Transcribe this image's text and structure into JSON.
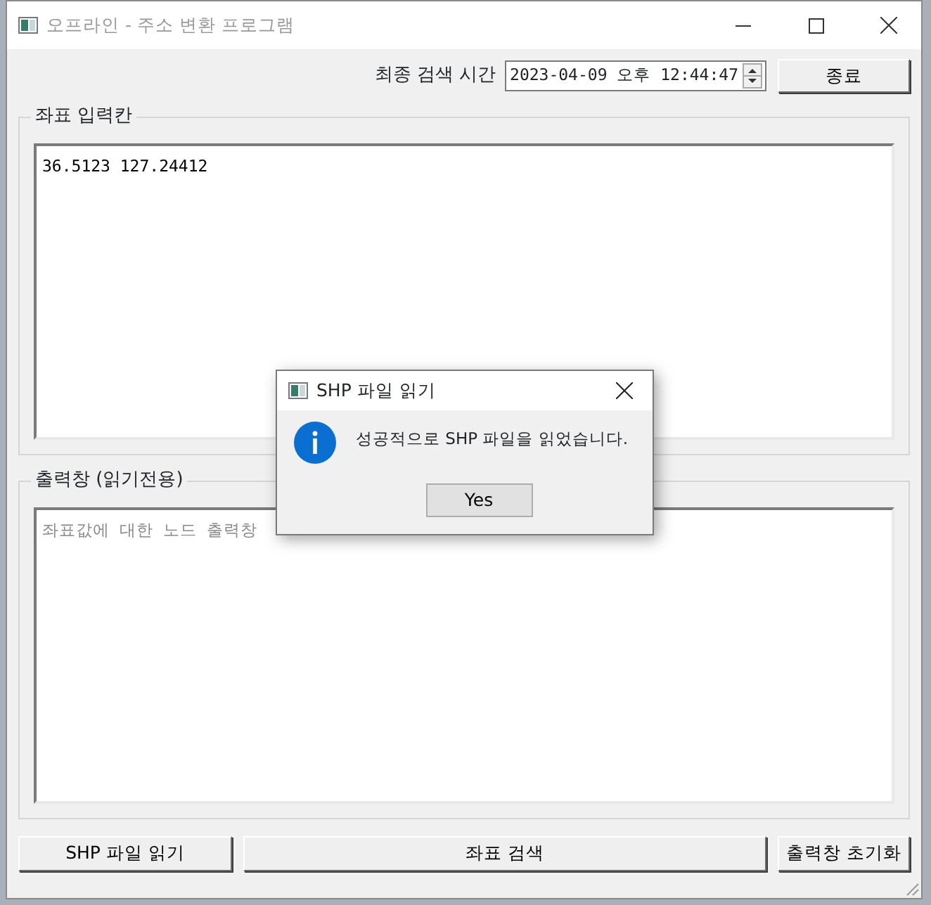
{
  "window": {
    "title": "오프라인 - 주소 변환 프로그램"
  },
  "toolbar": {
    "last_search_label": "최종 검색 시간",
    "last_search_value": "2023-04-09 오후 12:44:47",
    "exit_button": "종료"
  },
  "input_group": {
    "title": "좌표 입력칸",
    "value": "36.5123 127.24412"
  },
  "output_group": {
    "title": "출력창 (읽기전용)",
    "placeholder": "좌표값에 대한 노드 출력창"
  },
  "buttons": [
    "SHP 파일 읽기",
    "좌표 검색",
    "출력창 초기화"
  ],
  "dialog": {
    "title": "SHP 파일 읽기",
    "message": "성공적으로 SHP 파일을 읽었습니다.",
    "button": "Yes"
  }
}
